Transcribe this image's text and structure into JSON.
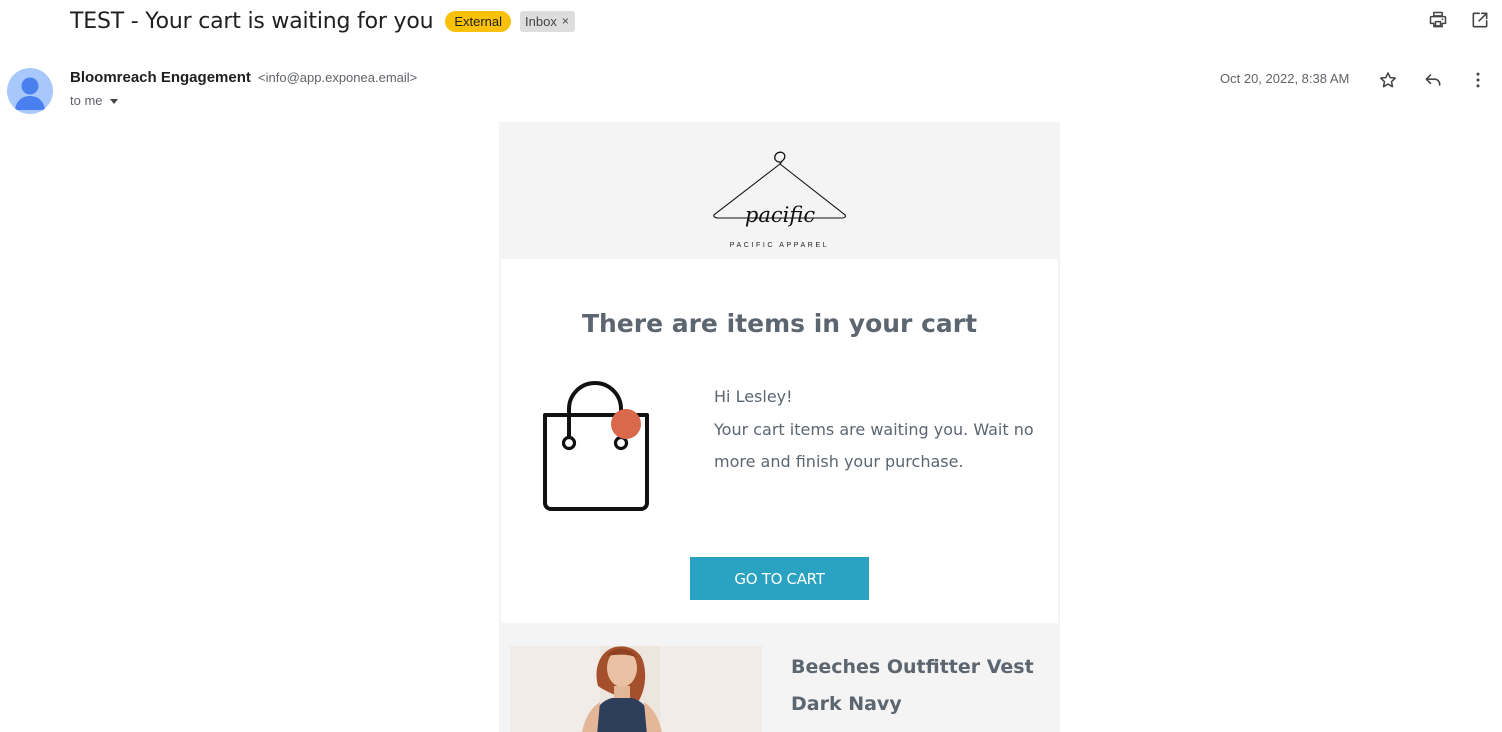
{
  "subject": {
    "title": "TEST - Your cart is waiting for you",
    "labels": {
      "external": "External",
      "inbox": "Inbox",
      "inbox_remove": "×"
    }
  },
  "toolbar": {
    "icons": [
      "print-icon",
      "open-in-new-window-icon"
    ]
  },
  "sender": {
    "name": "Bloomreach Engagement",
    "email": "<info@app.exponea.email>",
    "recipient": "to me",
    "date": "Oct 20, 2022, 8:38 AM",
    "actions": [
      "star-icon",
      "reply-icon",
      "more-vertical-icon"
    ]
  },
  "email": {
    "logo": {
      "script": "pacific",
      "tagline": "PACIFIC APPAREL"
    },
    "heading": "There are items in your cart",
    "greeting": "Hi Lesley!",
    "body": "Your cart items are waiting you. Wait no more and finish your purchase.",
    "cta": "GO TO CART",
    "product": {
      "name": "Beeches Outfitter Vest Dark Navy"
    }
  },
  "colors": {
    "external_chip": "#f9c109",
    "cta_background": "#2aa3c2",
    "bag_dot": "#d9694a",
    "text_gray": "#5c6670",
    "avatar": "#a8c7fa"
  }
}
